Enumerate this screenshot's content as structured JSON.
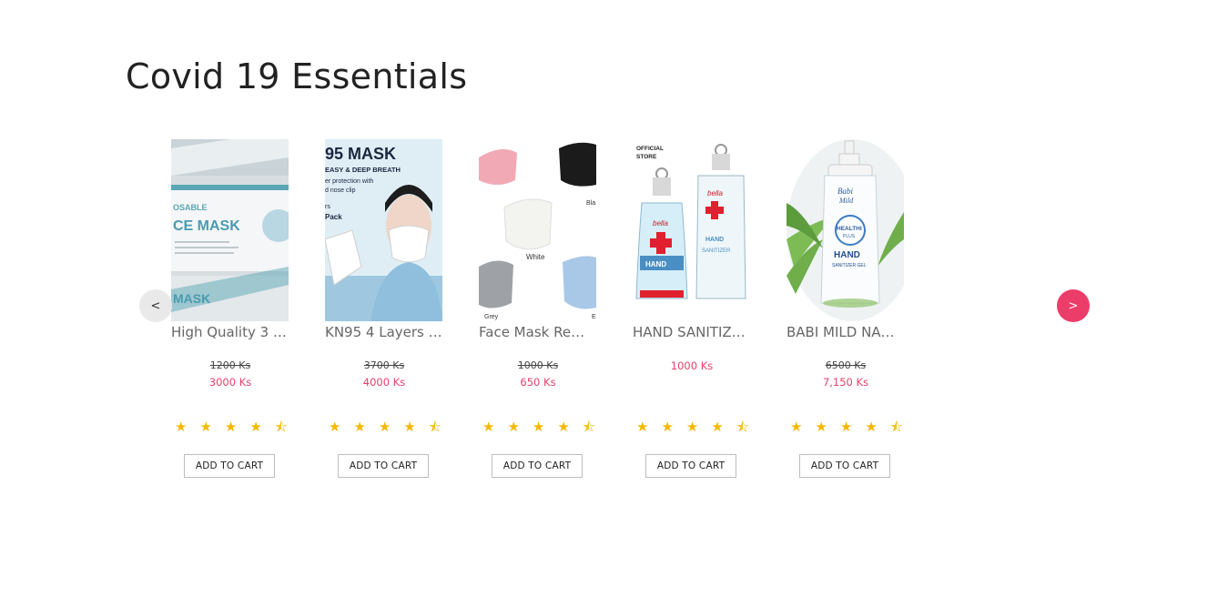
{
  "section": {
    "title": "Covid 19 Essentials"
  },
  "carousel": {
    "prev_label": "<",
    "next_label": ">"
  },
  "products": [
    {
      "name": "High Quality 3 …",
      "old_price": "1200 Ks",
      "price": "3000 Ks",
      "rating": 4.5,
      "cart_label": "ADD TO CART",
      "image_text": [
        "OSABLE",
        "CE MASK"
      ]
    },
    {
      "name": "KN95 4 Layers …",
      "old_price": "3700 Ks",
      "price": "4000 Ks",
      "rating": 4.5,
      "cart_label": "ADD TO CART",
      "image_text": [
        "95 MASK",
        "EASY & DEEP BREATH",
        "er protection with",
        "d nose clip",
        "rs",
        "Pack"
      ]
    },
    {
      "name": "Face Mask Re…",
      "old_price": "1000 Ks",
      "price": "650 Ks",
      "rating": 4.5,
      "cart_label": "ADD TO CART",
      "image_text": [
        "White",
        "Grey",
        "Bla",
        "E"
      ]
    },
    {
      "name": "HAND SANITIZ…",
      "old_price": "",
      "price": "1000 Ks",
      "rating": 4.5,
      "cart_label": "ADD TO CART",
      "image_text": [
        "OFFICIAL",
        "STORE",
        "bella",
        "HAND",
        "SANITIZER"
      ]
    },
    {
      "name": "BABI MILD NA…",
      "old_price": "6500 Ks",
      "price": "7,150 Ks",
      "rating": 4.5,
      "cart_label": "ADD TO CART",
      "image_text": [
        "Babi",
        "Mild",
        "HEALTHI",
        "PLUS",
        "HAND",
        "SANITIZER GEL"
      ]
    }
  ],
  "colors": {
    "accent": "#ec3d6a",
    "price": "#e8406c",
    "star": "#f5b800"
  }
}
